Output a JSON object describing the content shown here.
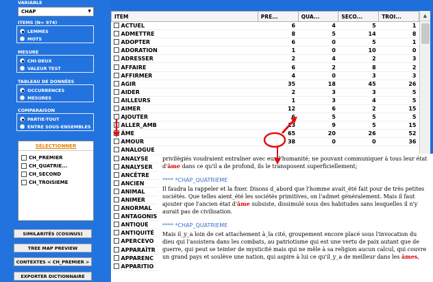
{
  "variable_label": "VARIABLE",
  "variable_value": "CHAP",
  "items_label": "ITEMS (N= 974)",
  "items_opts": [
    "LEMMES",
    "MOTS"
  ],
  "mesure_label": "MESURE",
  "mesure_opts": [
    "CHI-DEUX",
    "VALEUR TEST"
  ],
  "tableau_label": "TABLEAU DE DONNÉES",
  "tableau_opts": [
    "OCCURRENCES",
    "MESURES"
  ],
  "comp_label": "COMPARAISON",
  "comp_opts": [
    "PARTIE-TOUT",
    "ENTRE SOUS-ENSEMBLES"
  ],
  "select_header": "SÉLECTIONNER",
  "select_items": [
    "CH_PREMIER",
    "CH_QUATRIE...",
    "CH_SECOND",
    "CH_TROISIEME"
  ],
  "buttons": [
    "SIMILARITÉS (COSINUS)",
    "TREE MAP PREVIEW",
    "CONTEXTES < CH_PREMIER >",
    "EXPORTER DICTIONNAIRE"
  ],
  "columns": [
    "ITEM",
    "PRE...",
    "QUA...",
    "SECO...",
    "TROI..."
  ],
  "rows": [
    [
      "ACTUEL",
      "6",
      "4",
      "5",
      "1"
    ],
    [
      "ADMETTRE",
      "8",
      "5",
      "14",
      "8"
    ],
    [
      "ADOPTER",
      "6",
      "0",
      "5",
      "1"
    ],
    [
      "ADORATION",
      "1",
      "0",
      "10",
      "0"
    ],
    [
      "ADRESSER",
      "2",
      "4",
      "2",
      "3"
    ],
    [
      "AFFAIRE",
      "6",
      "2",
      "8",
      "2"
    ],
    [
      "AFFIRMER",
      "4",
      "0",
      "3",
      "3"
    ],
    [
      "AGIR",
      "35",
      "18",
      "45",
      "26"
    ],
    [
      "AIDER",
      "2",
      "3",
      "3",
      "5"
    ],
    [
      "AILLEURS",
      "1",
      "3",
      "4",
      "5"
    ],
    [
      "AIMER",
      "12",
      "6",
      "2",
      "15"
    ],
    [
      "AJOUTER",
      "6",
      "5",
      "5",
      "5"
    ],
    [
      "ALLER_AMB",
      "13",
      "9",
      "5",
      "15"
    ],
    [
      "ÂME",
      "65",
      "20",
      "26",
      "52"
    ],
    [
      "AMOUR",
      "38",
      "0",
      "0",
      "36"
    ],
    [
      "ANALOGUE",
      "",
      "",
      "",
      ""
    ],
    [
      "ANALYSE",
      "",
      "",
      "",
      ""
    ],
    [
      "ANALYSER",
      "",
      "",
      "",
      ""
    ],
    [
      "ANCÊTRE",
      "",
      "",
      "",
      ""
    ],
    [
      "ANCIEN",
      "",
      "",
      "",
      ""
    ],
    [
      "ANIMAL",
      "",
      "",
      "",
      ""
    ],
    [
      "ANIMER",
      "",
      "",
      "",
      ""
    ],
    [
      "ANORMAL",
      "",
      "",
      "",
      ""
    ],
    [
      "ANTAGONIS",
      "",
      "",
      "",
      ""
    ],
    [
      "ANTIQUE",
      "",
      "",
      "",
      ""
    ],
    [
      "ANTIQUITÉ",
      "",
      "",
      "",
      ""
    ],
    [
      "APERCEVO",
      "",
      "",
      "",
      ""
    ],
    [
      "APPARAÎTR",
      "",
      "",
      "",
      ""
    ],
    [
      "APPARENC",
      "",
      "",
      "",
      ""
    ],
    [
      "APPARITIO",
      "",
      "",
      "",
      ""
    ]
  ],
  "context": {
    "p1a": "privilégiés voudraient entraîner avec eux l'humanité; ne pouvant communiquer à tous leur état d'",
    "p1h": "âme",
    "p1b": " dans ce qu'il a de profond, ils le transposent superficiellement;",
    "h1": "**** *CHAP_QUATRIEME",
    "p2a": "Il faudra la rappeler et la fixer. Disons d_abord que l'homme avait_été fait pour de très petites sociétés. Que telles aient_été les sociétés primitives, on l'admet généralement. Mais il faut ajouter que l'ancien état d'",
    "p2h": "âme",
    "p2b": " subsiste, dissimulé sous des habitudes sans lesquelles il n'y aurait pas de civilisation.",
    "h2": "**** *CHAP_QUATRIEME",
    "p3a": "Mais il_y_a loin de cet attachement à_la cité, groupement encore placé sous l'invocation du dieu qui l'assistera dans les combats, au patriotisme qui est une vertu de paix autant que de guerre, qui peut se teinter de mysticité mais qui ne mêle à sa religion aucun calcul, qui couvre un grand pays et soulève une nation, qui aspire à lui ce qu'il_y_a de meilleur dans les ",
    "p3h": "âmes",
    "p3b": ","
  },
  "annotation_color": "#e01010"
}
